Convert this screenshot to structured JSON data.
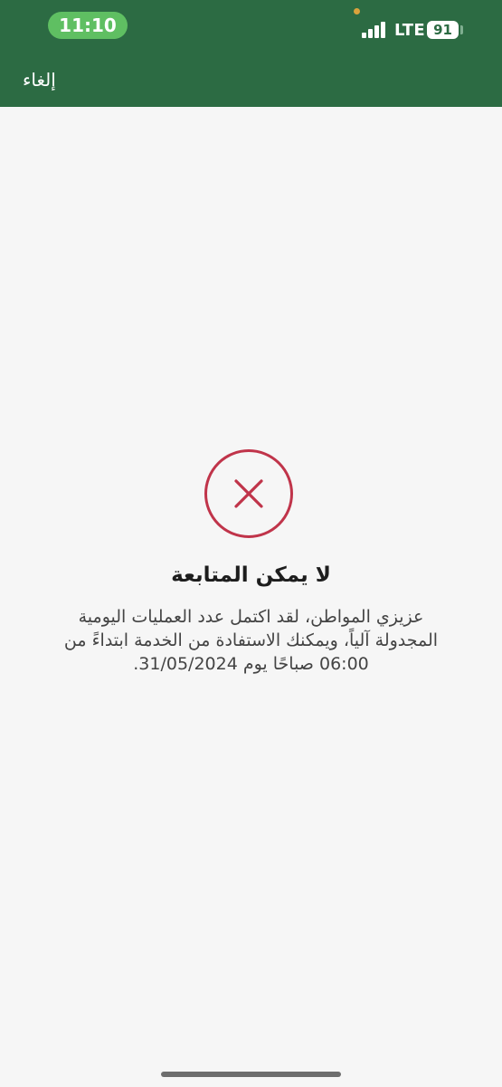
{
  "status_bar": {
    "time": "11:10",
    "network": "LTE",
    "battery": "91"
  },
  "nav": {
    "cancel_label": "إلغاء"
  },
  "dialog": {
    "icon": "x-icon",
    "title": "لا يمكن المتابعة",
    "message_line1": "عزيزي المواطن، لقد اكتمل عدد العمليات اليومية",
    "message_line2": "المجدولة آلياً، ويمكنك الاستفادة من الخدمة ابتداءً من",
    "message_line3": "06:00 صباحًا يوم 31/05/2024."
  },
  "colors": {
    "header": "#2c6b43",
    "time_pill": "#5fbf62",
    "error": "#c0344a",
    "background": "#f6f6f6"
  }
}
